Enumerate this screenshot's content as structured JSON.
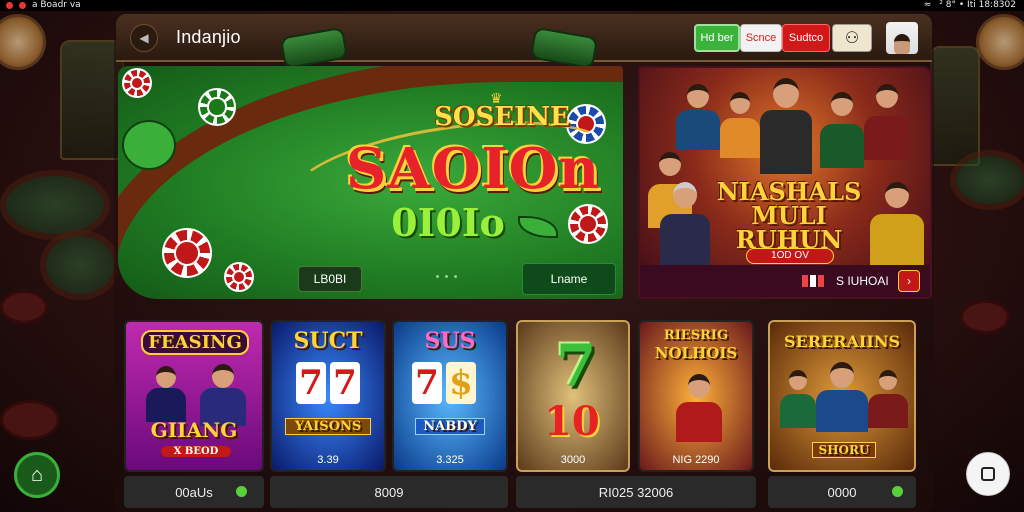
{
  "status_bar": {
    "left_text": "a Boadr va",
    "right_text": "² 8° • Iti 18:8302"
  },
  "header": {
    "title": "Indanjio",
    "btn_green_label": "Hd ber",
    "btn_white_label": "Scnce",
    "btn_red_label": "Sudtco",
    "btn_circle_icon": "⚇"
  },
  "main_banner": {
    "subtitle": "SOSEINE",
    "title": "SAOIOn",
    "number": "0I0Io",
    "left_button_label": "LB0BI",
    "right_button_label": "Lname"
  },
  "side_banner": {
    "title_line1": "NIASHALS",
    "title_line2": "MULI RUHUN",
    "badge": "1OD OV",
    "footer_text": "S IUHOAI"
  },
  "cards": [
    {
      "title": "FEASING",
      "subtitle": "GIIANG",
      "tag": "X BEOD",
      "footer": "00aUs",
      "bg": "#a21a9a"
    },
    {
      "title": "SUCT",
      "subtitle": "YAISONS",
      "price": "3.39",
      "footer": "",
      "bg": "#1a3aa2"
    },
    {
      "title": "SUS",
      "subtitle": "NABDY",
      "price": "3.325",
      "footer": "8009",
      "bg": "#1a5ac2"
    },
    {
      "title": "7",
      "subtitle": "10",
      "price": "3000",
      "footer": "",
      "bg": "#7a5a2a"
    },
    {
      "title": "RIESRIG",
      "subtitle": "NOLHOIS",
      "price": "NIG 2290",
      "footer": "RI025 32006",
      "bg": "#d07a1a"
    },
    {
      "title": "SERERAIINS",
      "subtitle": "SHORU",
      "footer": "0000",
      "bg": "#b05a1a"
    }
  ],
  "fab_left_icon": "⌂",
  "colors": {
    "table_green": "#1f7a22",
    "accent_gold": "#ffd23a",
    "accent_red": "#d01818"
  }
}
